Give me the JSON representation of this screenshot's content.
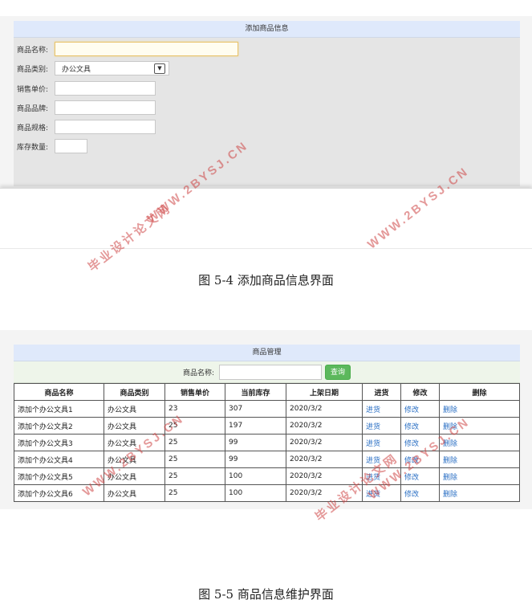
{
  "form_screen": {
    "panel_title": "添加商品信息",
    "fields": [
      {
        "label": "商品名称:",
        "value": ""
      },
      {
        "label": "商品类别:",
        "value": "办公文具"
      },
      {
        "label": "销售单价:",
        "value": ""
      },
      {
        "label": "商品品牌:",
        "value": ""
      },
      {
        "label": "商品规格:",
        "value": ""
      },
      {
        "label": "库存数量:",
        "value": ""
      }
    ]
  },
  "caption_1": "图 5-4 添加商品信息界面",
  "manage_screen": {
    "panel_title": "商品管理",
    "search_label": "商品名称:",
    "search_value": "",
    "query_button": "查询",
    "columns": [
      "商品名称",
      "商品类别",
      "销售单价",
      "当前库存",
      "上架日期",
      "进货",
      "修改",
      "删除"
    ],
    "rows": [
      {
        "name": "添加个办公文具1",
        "category": "办公文具",
        "price": "23",
        "stock": "307",
        "date": "2020/3/2",
        "restock": "进货",
        "edit": "修改",
        "delete": "删除"
      },
      {
        "name": "添加个办公文具2",
        "category": "办公文具",
        "price": "25",
        "stock": "197",
        "date": "2020/3/2",
        "restock": "进货",
        "edit": "修改",
        "delete": "删除"
      },
      {
        "name": "添加个办公文具3",
        "category": "办公文具",
        "price": "25",
        "stock": "99",
        "date": "2020/3/2",
        "restock": "进货",
        "edit": "修改",
        "delete": "删除"
      },
      {
        "name": "添加个办公文具4",
        "category": "办公文具",
        "price": "25",
        "stock": "99",
        "date": "2020/3/2",
        "restock": "进货",
        "edit": "修改",
        "delete": "删除"
      },
      {
        "name": "添加个办公文具5",
        "category": "办公文具",
        "price": "25",
        "stock": "100",
        "date": "2020/3/2",
        "restock": "进货",
        "edit": "修改",
        "delete": "删除"
      },
      {
        "name": "添加个办公文具6",
        "category": "办公文具",
        "price": "25",
        "stock": "100",
        "date": "2020/3/2",
        "restock": "进货",
        "edit": "修改",
        "delete": "删除"
      }
    ]
  },
  "caption_2": "图 5-5 商品信息维护界面",
  "watermark": {
    "site": "WWW.2BYSJ.CN",
    "name": "毕业设计论文网"
  },
  "colors": {
    "title_bar": "#dfe9fb",
    "panel_bg": "#e5e5e5",
    "search_bg": "#eef5ea",
    "query_button": "#5cb85c",
    "link": "#2a6fc4",
    "watermark": "#cd4646"
  }
}
